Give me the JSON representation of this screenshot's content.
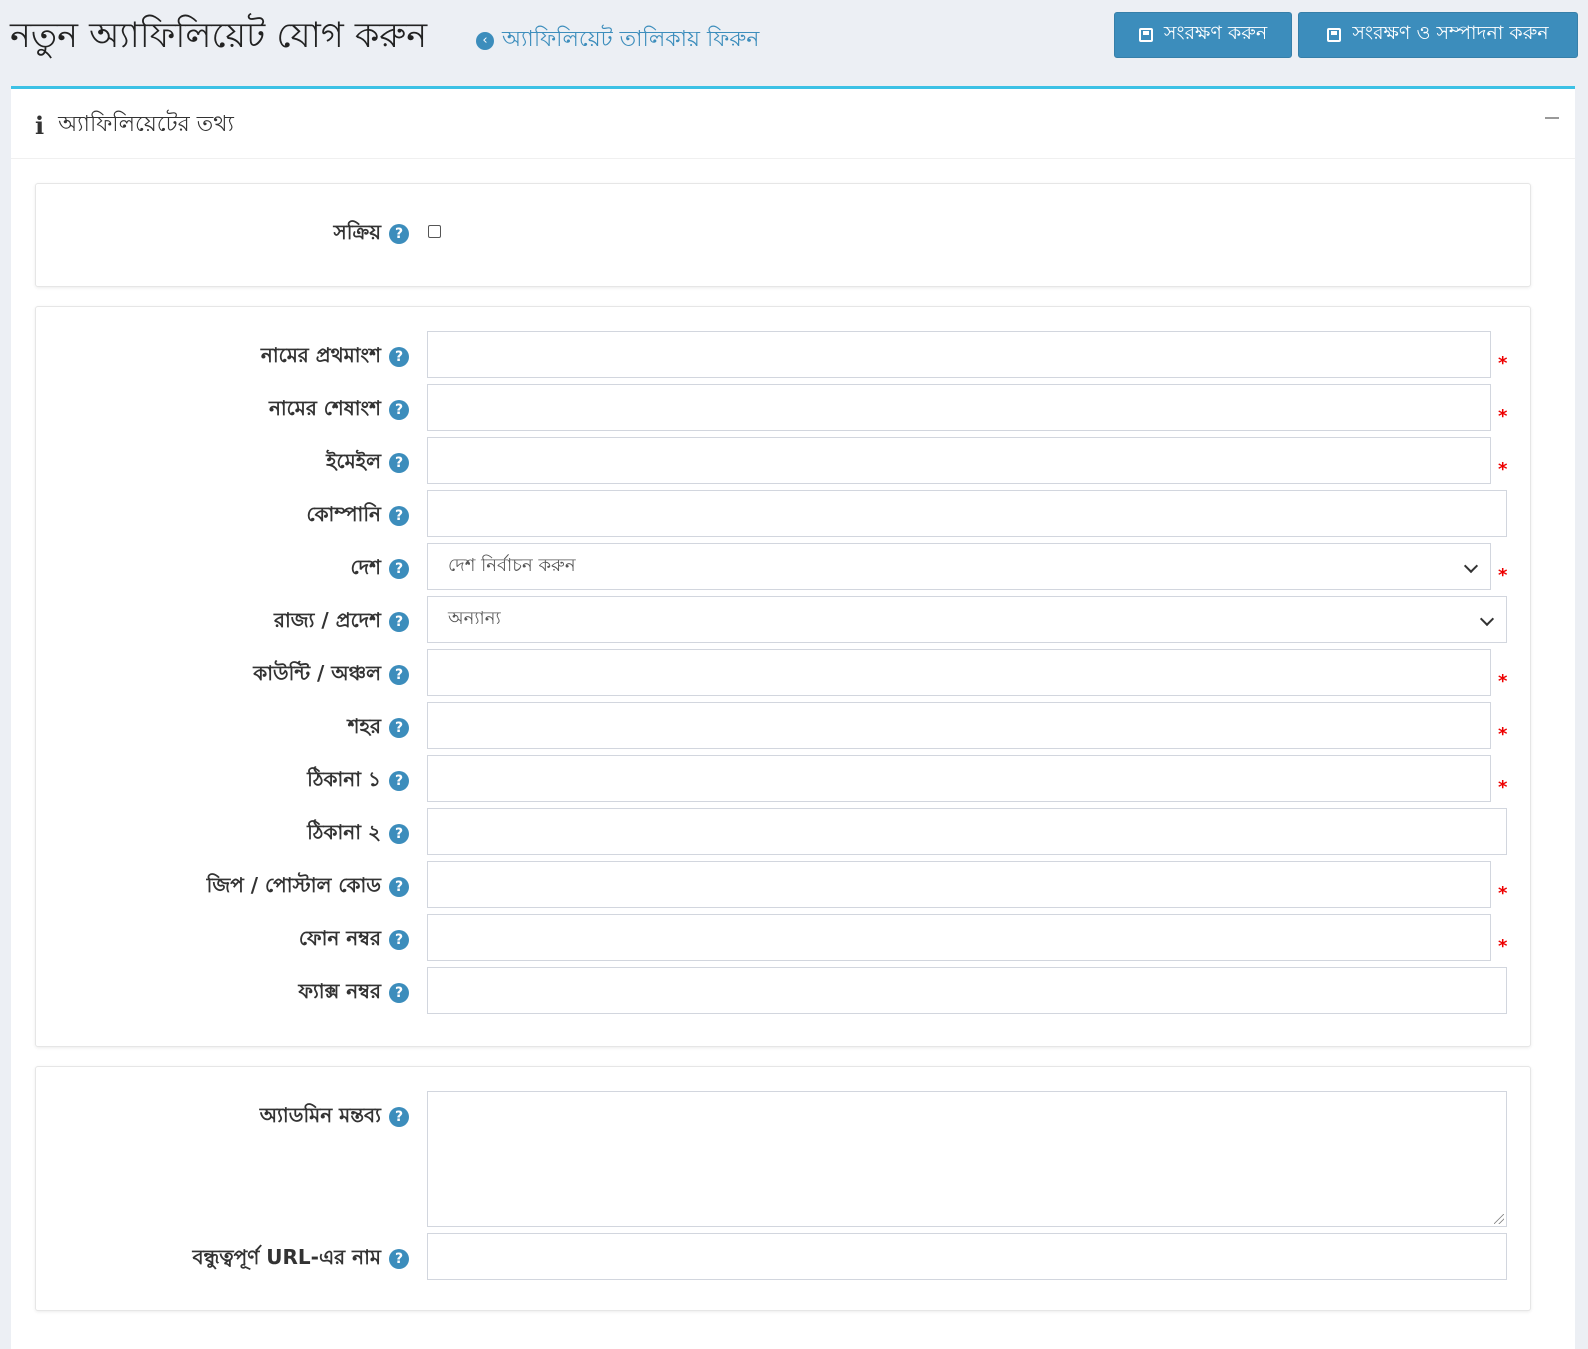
{
  "header": {
    "title": "নতুন অ্যাফিলিয়েট যোগ করুন",
    "back_link": "অ্যাফিলিয়েট তালিকায় ফিরুন",
    "save_label": "সংরক্ষণ করুন",
    "save_edit_label": "সংরক্ষণ ও সম্পাদনা করুন"
  },
  "card": {
    "title": "অ্যাফিলিয়েটের তথ্য",
    "info_icon": "i"
  },
  "active": {
    "label": "সক্রিয়",
    "checked": false
  },
  "fields": {
    "first_name": {
      "label": "নামের প্রথমাংশ",
      "value": "",
      "required": true
    },
    "last_name": {
      "label": "নামের শেষাংশ",
      "value": "",
      "required": true
    },
    "email": {
      "label": "ইমেইল",
      "value": "",
      "required": true
    },
    "company": {
      "label": "কোম্পানি",
      "value": "",
      "required": false
    },
    "country": {
      "label": "দেশ",
      "selected": "দেশ নির্বাচন করুন",
      "required": true
    },
    "state": {
      "label": "রাজ্য / প্রদেশ",
      "selected": "অন্যান্য",
      "required": false
    },
    "county": {
      "label": "কাউন্টি / অঞ্চল",
      "value": "",
      "required": true
    },
    "city": {
      "label": "শহর",
      "value": "",
      "required": true
    },
    "address1": {
      "label": "ঠিকানা ১",
      "value": "",
      "required": true
    },
    "address2": {
      "label": "ঠিকানা ২",
      "value": "",
      "required": false
    },
    "zip": {
      "label": "জিপ / পোস্টাল কোড",
      "value": "",
      "required": true
    },
    "phone": {
      "label": "ফোন নম্বর",
      "value": "",
      "required": true
    },
    "fax": {
      "label": "ফ্যাক্স নম্বর",
      "value": "",
      "required": false
    }
  },
  "admin": {
    "comment_label": "অ্যাডমিন মন্তব্য",
    "comment_value": "",
    "friendly_url_label": "বন্ধুত্বপূর্ণ URL-এর নাম",
    "friendly_url_value": ""
  },
  "ui": {
    "required_mark": "*",
    "help_glyph": "?",
    "back_glyph": "‹"
  },
  "colors": {
    "accent": "#3c8dbc",
    "card_top_border": "#3cc1e5",
    "required": "#e00000",
    "background": "#eceff4"
  },
  "icons": [
    "arrow-left-circle-icon",
    "save-icon",
    "info-icon",
    "minus-icon",
    "help-icon",
    "chevron-down-icon"
  ]
}
